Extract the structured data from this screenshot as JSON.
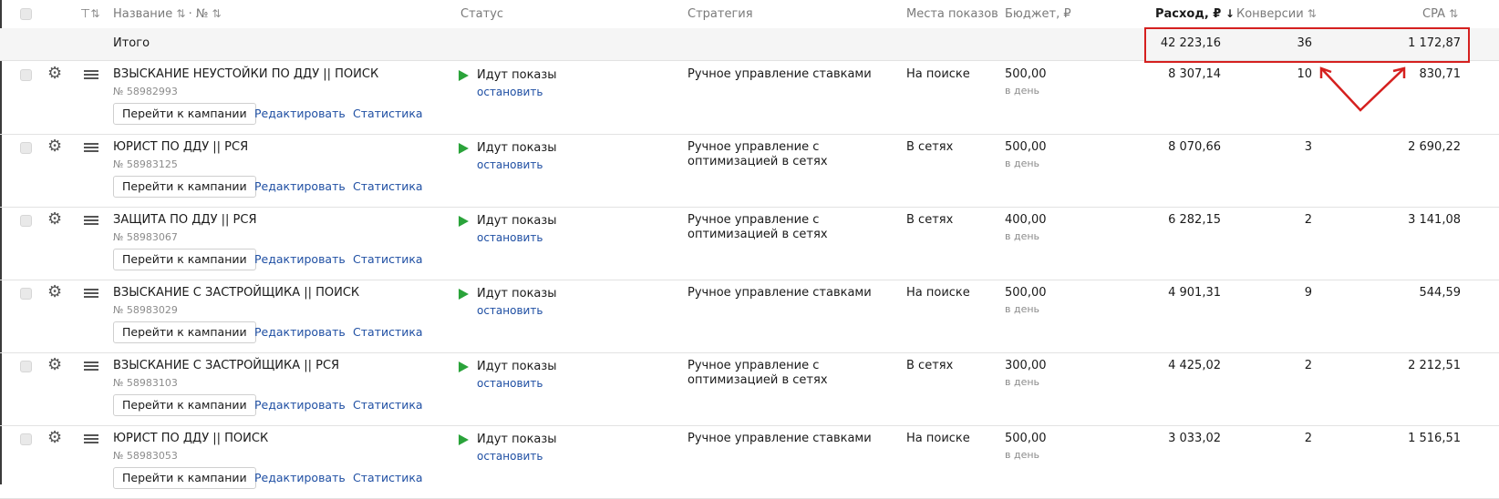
{
  "header": {
    "filter_icon": "filter-icon",
    "name": "Название",
    "num": "№",
    "dot": "·",
    "status": "Статус",
    "strategy": "Стратегия",
    "places": "Места показов",
    "budget": "Бюджет, ₽",
    "spend": "Расход, ₽",
    "conversions": "Конверсии",
    "cpa": "CPA",
    "sort_icon": "⇅",
    "sort_desc_icon": "↓"
  },
  "total": {
    "label": "Итого",
    "spend": "42 223,16",
    "conversions": "36",
    "cpa": "1 172,87"
  },
  "rows": [
    {
      "name": "ВЗЫСКАНИЕ НЕУСТОЙКИ ПО ДДУ || ПОИСК",
      "id": "№ 58982993",
      "status": "Идут показы",
      "stop": "остановить",
      "strategy": "Ручное управление ставками",
      "place": "На поиске",
      "budget": "500,00",
      "per_day": "в день",
      "spend": "8 307,14",
      "conversions": "10",
      "cpa": "830,71",
      "goto": "Перейти к кампании",
      "edit": "Редактировать",
      "stats": "Статистика"
    },
    {
      "name": "ЮРИСТ ПО ДДУ || РСЯ",
      "id": "№ 58983125",
      "status": "Идут показы",
      "stop": "остановить",
      "strategy": "Ручное управление с оптимизацией в сетях",
      "place": "В сетях",
      "budget": "500,00",
      "per_day": "в день",
      "spend": "8 070,66",
      "conversions": "3",
      "cpa": "2 690,22",
      "goto": "Перейти к кампании",
      "edit": "Редактировать",
      "stats": "Статистика"
    },
    {
      "name": "ЗАЩИТА ПО ДДУ || РСЯ",
      "id": "№ 58983067",
      "status": "Идут показы",
      "stop": "остановить",
      "strategy": "Ручное управление с оптимизацией в сетях",
      "place": "В сетях",
      "budget": "400,00",
      "per_day": "в день",
      "spend": "6 282,15",
      "conversions": "2",
      "cpa": "3 141,08",
      "goto": "Перейти к кампании",
      "edit": "Редактировать",
      "stats": "Статистика"
    },
    {
      "name": "ВЗЫСКАНИЕ С ЗАСТРОЙЩИКА || ПОИСК",
      "id": "№ 58983029",
      "status": "Идут показы",
      "stop": "остановить",
      "strategy": "Ручное управление ставками",
      "place": "На поиске",
      "budget": "500,00",
      "per_day": "в день",
      "spend": "4 901,31",
      "conversions": "9",
      "cpa": "544,59",
      "goto": "Перейти к кампании",
      "edit": "Редактировать",
      "stats": "Статистика"
    },
    {
      "name": "ВЗЫСКАНИЕ С ЗАСТРОЙЩИКА || РСЯ",
      "id": "№ 58983103",
      "status": "Идут показы",
      "stop": "остановить",
      "strategy": "Ручное управление с оптимизацией в сетях",
      "place": "В сетях",
      "budget": "300,00",
      "per_day": "в день",
      "spend": "4 425,02",
      "conversions": "2",
      "cpa": "2 212,51",
      "goto": "Перейти к кампании",
      "edit": "Редактировать",
      "stats": "Статистика"
    },
    {
      "name": "ЮРИСТ ПО ДДУ || ПОИСК",
      "id": "№ 58983053",
      "status": "Идут показы",
      "stop": "остановить",
      "strategy": "Ручное управление ставками",
      "place": "На поиске",
      "budget": "500,00",
      "per_day": "в день",
      "spend": "3 033,02",
      "conversions": "2",
      "cpa": "1 516,51",
      "goto": "Перейти к кампании",
      "edit": "Редактировать",
      "stats": "Статистика"
    }
  ],
  "colors": {
    "accent_red": "#d5201f",
    "play_green": "#2aa33a",
    "link_blue": "#1f4fa3"
  }
}
